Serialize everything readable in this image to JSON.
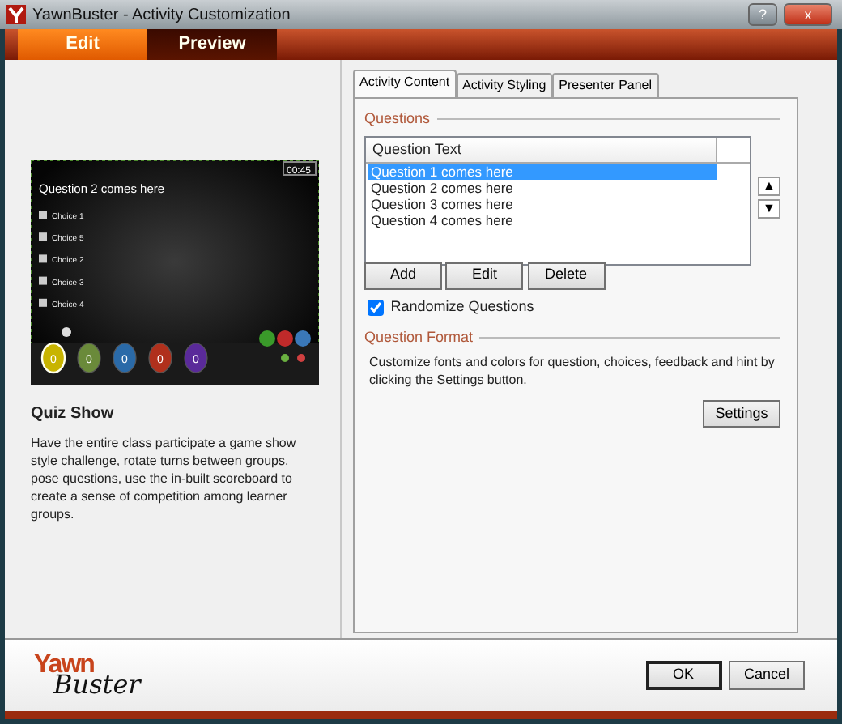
{
  "window": {
    "title": "YawnBuster - Activity Customization",
    "help_button": "?",
    "close_button": "x"
  },
  "mode_tabs": [
    {
      "label": "Edit",
      "selected": true
    },
    {
      "label": "Preview",
      "selected": false
    }
  ],
  "preview": {
    "question": "Question 2 comes here",
    "timer": "00:45",
    "choices": [
      {
        "label": "Choice 1",
        "checked": false
      },
      {
        "label": "Choice 5",
        "checked": false
      },
      {
        "label": "Choice 2",
        "checked": false
      },
      {
        "label": "Choice 3",
        "checked": false
      },
      {
        "label": "Choice 4",
        "checked": false
      }
    ],
    "groups": [
      {
        "score": "0",
        "color": "#c8b400",
        "selected": true
      },
      {
        "score": "0",
        "color": "#6a8a3a",
        "selected": false
      },
      {
        "score": "0",
        "color": "#2a6aa8",
        "selected": false
      },
      {
        "score": "0",
        "color": "#b0301c",
        "selected": false
      },
      {
        "score": "0",
        "color": "#5a2a9a",
        "selected": false
      }
    ]
  },
  "activity": {
    "title": "Quiz Show",
    "description": "Have the entire class participate a game show style challenge, rotate turns between groups, pose questions, use the in-built scoreboard to create a sense of competition among learner groups."
  },
  "tabs": [
    {
      "label": "Activity Content",
      "selected": true
    },
    {
      "label": "Activity Styling",
      "selected": false
    },
    {
      "label": "Presenter Panel",
      "selected": false
    }
  ],
  "questions": {
    "legend": "Questions",
    "column": "Question Text",
    "rows": [
      {
        "text": "Question 1 comes here",
        "selected": true
      },
      {
        "text": "Question 2 comes here",
        "selected": false
      },
      {
        "text": "Question 3 comes here",
        "selected": false
      },
      {
        "text": "Question 4 comes here",
        "selected": false
      }
    ],
    "move_buttons": [
      "▲",
      "▼"
    ],
    "buttons": [
      "Add",
      "Edit",
      "Delete"
    ]
  },
  "randomize": {
    "label": "Randomize Questions",
    "checked": true
  },
  "question_format": {
    "legend": "Question Format",
    "text": "Customize fonts and colors for question, choices, feedback and hint by clicking the Settings button.",
    "button": "Settings"
  },
  "logo": {
    "top": "Yawn",
    "bottom": "Buster"
  },
  "footer_buttons": [
    {
      "label": "OK",
      "default": true
    },
    {
      "label": "Cancel",
      "default": false
    }
  ]
}
